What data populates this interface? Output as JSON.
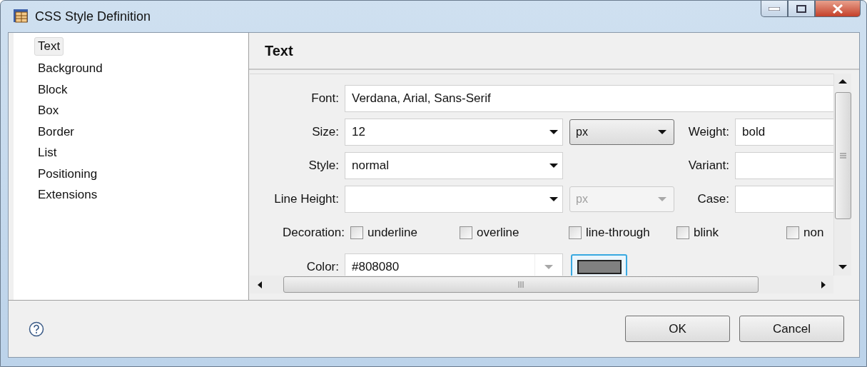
{
  "window": {
    "title": "CSS Style Definition"
  },
  "sidebar": {
    "items": [
      {
        "label": "Text",
        "selected": true
      },
      {
        "label": "Background",
        "selected": false
      },
      {
        "label": "Block",
        "selected": false
      },
      {
        "label": "Box",
        "selected": false
      },
      {
        "label": "Border",
        "selected": false
      },
      {
        "label": "List",
        "selected": false
      },
      {
        "label": "Positioning",
        "selected": false
      },
      {
        "label": "Extensions",
        "selected": false
      }
    ]
  },
  "panel": {
    "title": "Text"
  },
  "form": {
    "font": {
      "label": "Font:",
      "value": "Verdana, Arial, Sans-Serif"
    },
    "size": {
      "label": "Size:",
      "value": "12"
    },
    "size_unit": {
      "value": "px",
      "disabled": false
    },
    "weight": {
      "label": "Weight:",
      "value": "bold"
    },
    "style": {
      "label": "Style:",
      "value": "normal"
    },
    "variant": {
      "label": "Variant:"
    },
    "line_height": {
      "label": "Line Height:"
    },
    "line_height_unit": {
      "value": "px",
      "disabled": true
    },
    "case": {
      "label": "Case:"
    },
    "decoration": {
      "label": "Decoration:",
      "options": [
        {
          "label": "underline",
          "checked": false
        },
        {
          "label": "overline",
          "checked": false
        },
        {
          "label": "line-through",
          "checked": false
        },
        {
          "label": "blink",
          "checked": false
        },
        {
          "label": "non",
          "checked": false
        }
      ]
    },
    "color": {
      "label": "Color:",
      "value": "#808080"
    }
  },
  "buttons": [
    "OK",
    "Cancel"
  ]
}
